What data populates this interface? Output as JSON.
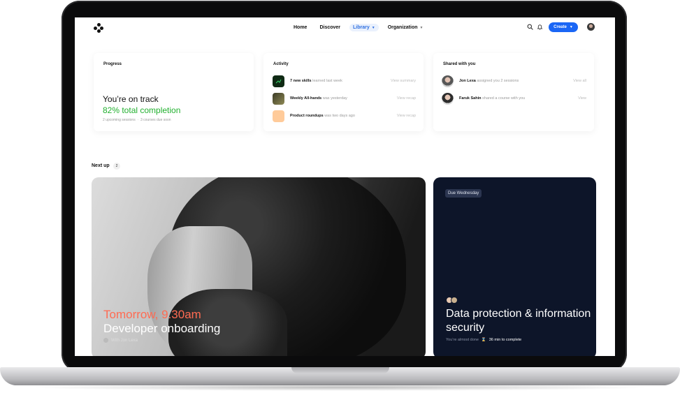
{
  "nav": {
    "links": [
      {
        "label": "Home",
        "active": false,
        "dropdown": false
      },
      {
        "label": "Discover",
        "active": false,
        "dropdown": false
      },
      {
        "label": "Library",
        "active": true,
        "dropdown": true
      },
      {
        "label": "Organization",
        "active": false,
        "dropdown": true
      }
    ],
    "create_label": "Create",
    "icons": [
      "logo-icon",
      "search-icon",
      "bell-icon",
      "chevron-down-icon",
      "avatar"
    ]
  },
  "progress_card": {
    "title": "Progress",
    "status": "You’re on track",
    "completion": "82% total completion",
    "sessions": "2 upcoming sessions",
    "courses_due": "3 courses due soon"
  },
  "activity_card": {
    "title": "Activity",
    "items": [
      {
        "strong": "7 new skills",
        "meta": "learned last week",
        "link": "View summary",
        "thumb_color": "#0f2a14"
      },
      {
        "strong": "Weekly All-hands",
        "meta": "was yesterday",
        "link": "View recap",
        "thumb_color": "#6b6a3f"
      },
      {
        "strong": "Product roundups",
        "meta": "was two days ago",
        "link": "View recap",
        "thumb_color": "#ffcb9a"
      }
    ]
  },
  "shared_card": {
    "title": "Shared with you",
    "items": [
      {
        "name": "Jon Lexa",
        "meta": "assigned you 2 sessions",
        "link": "View all"
      },
      {
        "name": "Faruk Sahin",
        "meta": "shared a course with you",
        "link": "View"
      }
    ]
  },
  "next_up": {
    "label": "Next up",
    "count": "2"
  },
  "feature": {
    "time": "Tomorrow, 9.30am",
    "title": "Developer onboarding",
    "with": "With Jon Lexa"
  },
  "course": {
    "due": "Due Wednesday",
    "title": "Data protection & information security",
    "progress_note": "You’re almost done",
    "time_left": "36 min to complete"
  },
  "colors": {
    "accent_blue": "#1a66f5",
    "success_green": "#22b02f",
    "feature_time": "#ff6b52",
    "course_bg": "#0d1529"
  }
}
